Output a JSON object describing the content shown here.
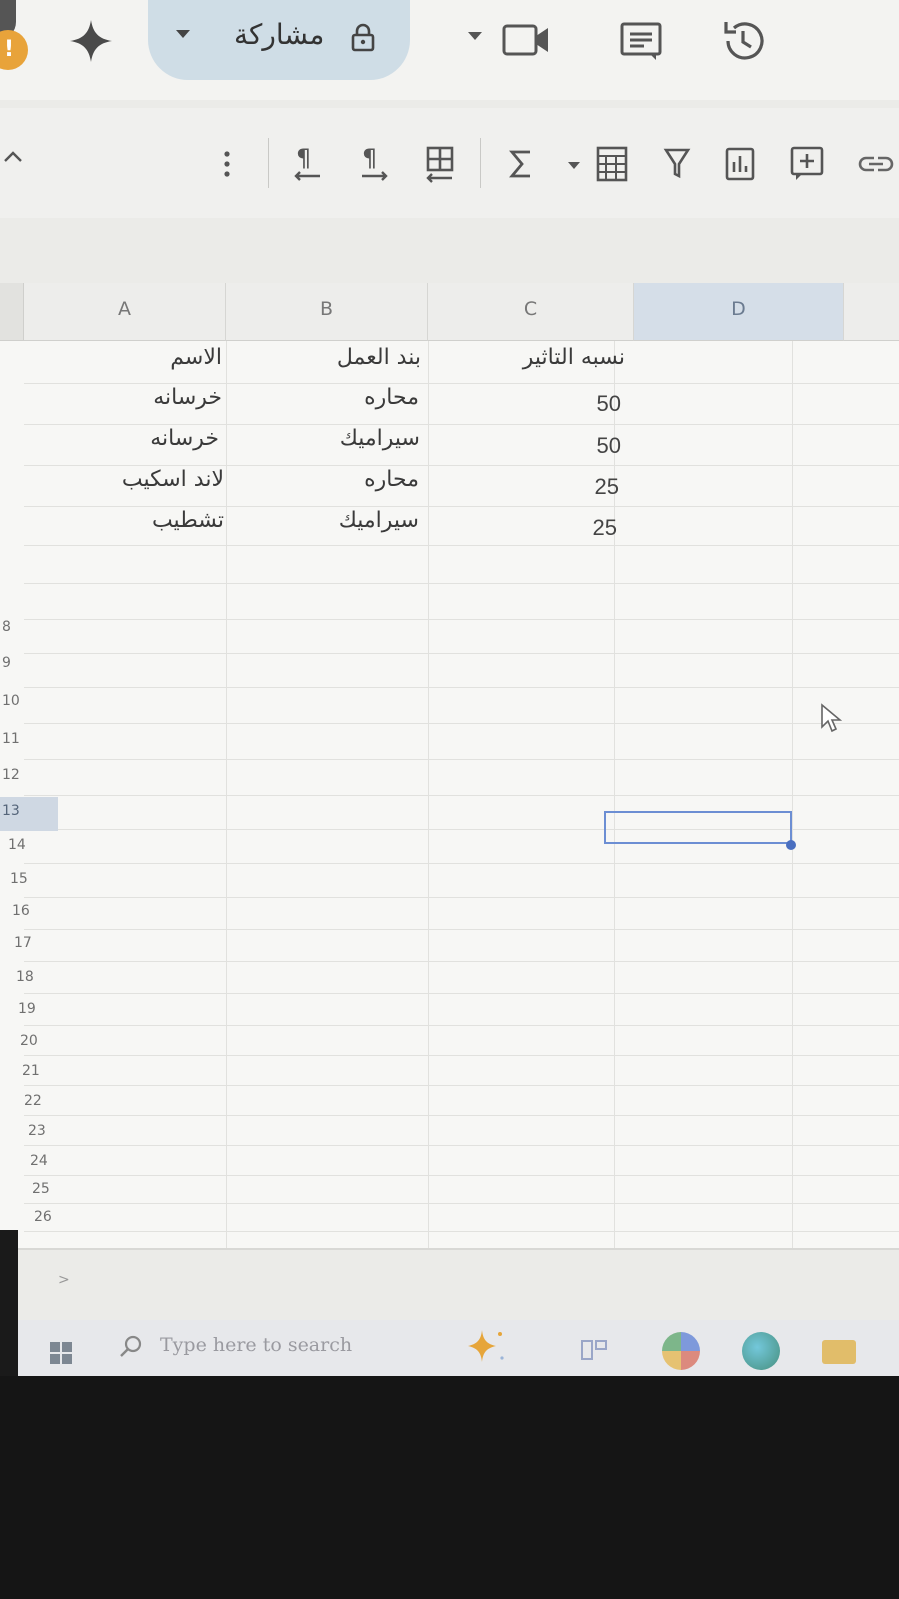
{
  "topbar": {
    "share_label": "مشاركة",
    "alert_badge": "!"
  },
  "toolbar": {
    "icons": [
      "more-vert-icon",
      "rtl-paragraph-icon",
      "ltr-paragraph-icon",
      "merge-cells-icon",
      "sum-icon",
      "function-caret-icon",
      "table-format-icon",
      "filter-icon",
      "chart-icon",
      "insert-comment-icon",
      "link-icon"
    ]
  },
  "grid": {
    "columns": [
      "A",
      "B",
      "C",
      "D"
    ],
    "selected_column": "D",
    "rows": [
      {
        "a": "الاسم",
        "b": "بند العمل",
        "c": "نسبه التاثير"
      },
      {
        "a": "خرسانه",
        "b": "محاره",
        "c": "50"
      },
      {
        "a": "خرسانه",
        "b": "سيراميك",
        "c": "50"
      },
      {
        "a": "لاند اسكيب",
        "b": "محاره",
        "c": "25"
      },
      {
        "a": "تشطيب",
        "b": "سيراميك",
        "c": "25"
      }
    ],
    "row_numbers": [
      "8",
      "9",
      "10",
      "11",
      "12",
      "13",
      "14",
      "15",
      "16",
      "17",
      "18",
      "19",
      "20",
      "21",
      "22",
      "23",
      "24",
      "25",
      "26"
    ],
    "selected_row": "13"
  },
  "sheetbar": {
    "arrow": ">"
  },
  "taskbar": {
    "search_placeholder": "Type here to search"
  },
  "colors": {
    "selection": "#6c8ed3",
    "share_pill": "#cfdde6",
    "alert": "#e8a33a"
  }
}
